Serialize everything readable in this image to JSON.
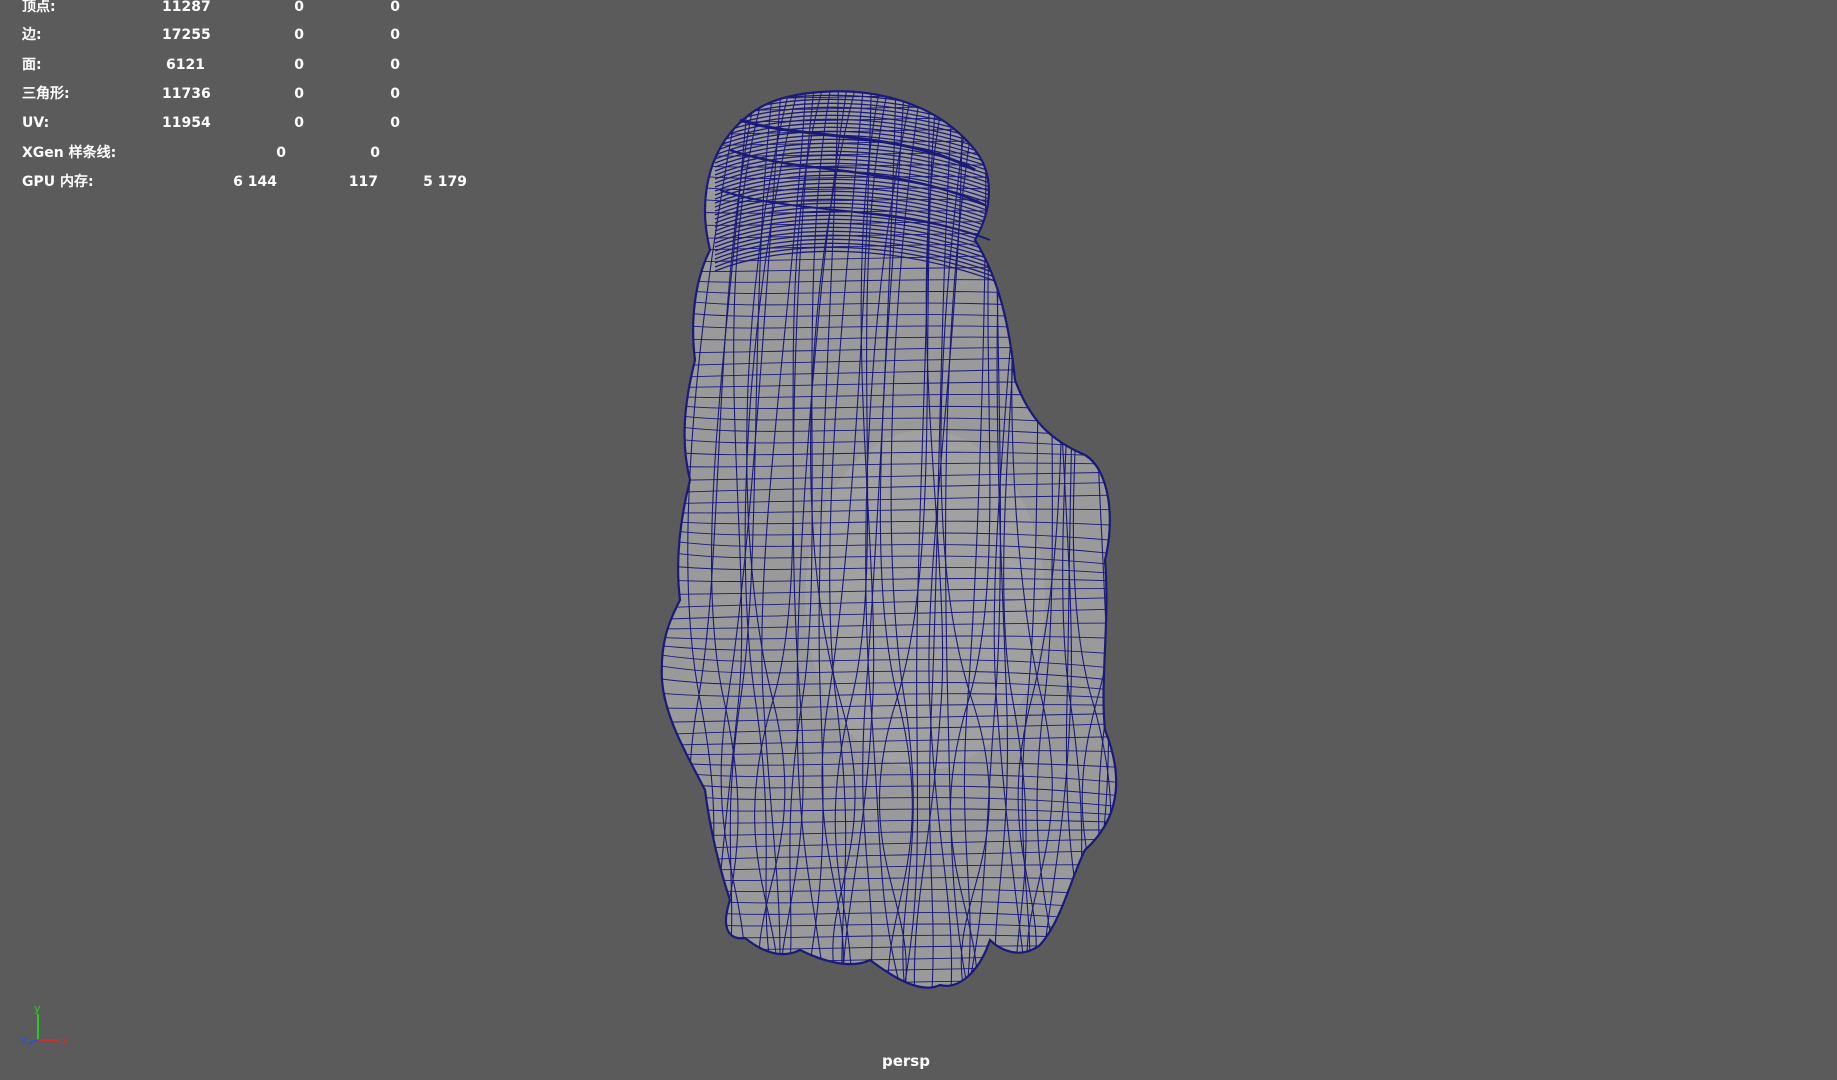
{
  "hud": {
    "rows": [
      {
        "label": "顶点:",
        "v1": "11287",
        "v2": "0",
        "v3": "0"
      },
      {
        "label": "边:",
        "v1": "17255",
        "v2": "0",
        "v3": "0"
      },
      {
        "label": "面:",
        "v1": "6121",
        "v2": "0",
        "v3": "0"
      },
      {
        "label": "三角形:",
        "v1": "11736",
        "v2": "0",
        "v3": "0"
      },
      {
        "label": "UV:",
        "v1": "11954",
        "v2": "0",
        "v3": "0"
      },
      {
        "label": "XGen 样条线:",
        "v1": "0",
        "v2": "0"
      },
      {
        "label": "GPU 内存:",
        "v1": "6 144",
        "v2": "117",
        "v3": "5 179"
      }
    ]
  },
  "viewport": {
    "camera_label": "persp",
    "background_color": "#5b5b5b",
    "wireframe_color": "#1a1a7a",
    "shaded_color": "#9a9a9a"
  },
  "axis_gizmo": {
    "x_label": "x",
    "y_label": "y",
    "z_label": "z"
  }
}
